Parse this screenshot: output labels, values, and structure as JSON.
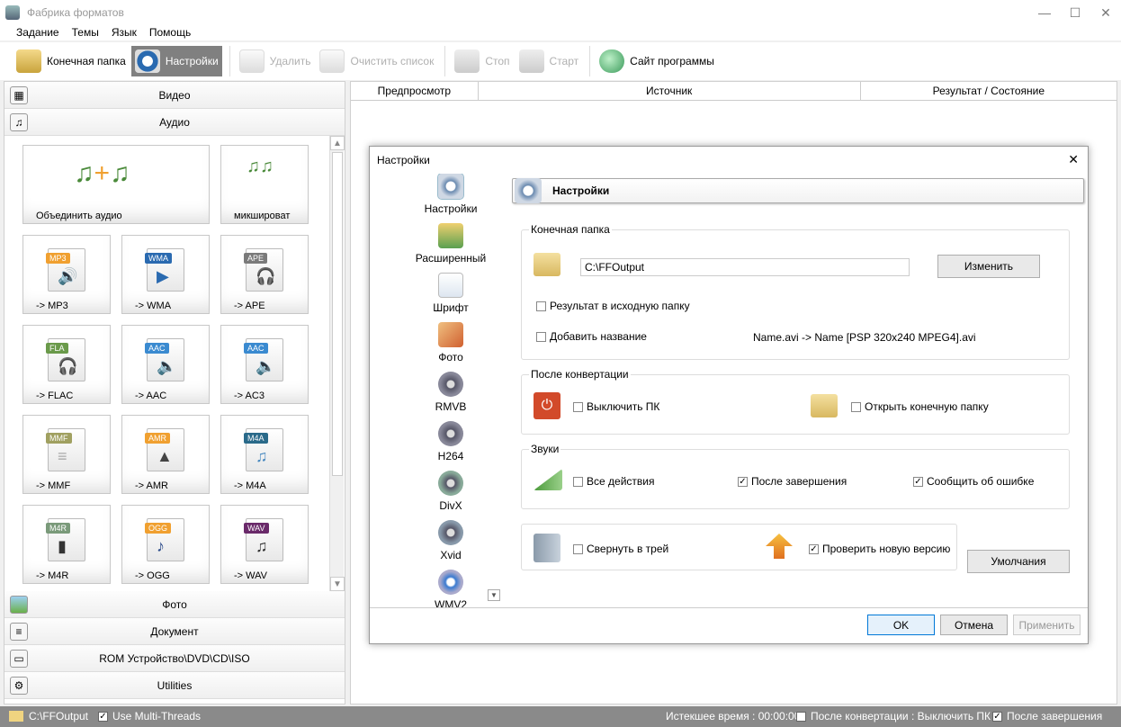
{
  "window": {
    "title": "Фабрика форматов",
    "controls": {
      "minimize": "—",
      "maximize": "☐",
      "close": "✕"
    }
  },
  "menu": [
    "Задание",
    "Темы",
    "Язык",
    "Помощь"
  ],
  "toolbar": {
    "output_folder": "Конечная папка",
    "settings": "Настройки",
    "delete": "Удалить",
    "clear_list": "Очистить список",
    "stop": "Стоп",
    "start": "Старт",
    "website": "Сайт программы"
  },
  "categories_top": [
    {
      "label": "Видео",
      "icon": "film-icon"
    },
    {
      "label": "Аудио",
      "icon": "music-icon"
    }
  ],
  "audio_tiles": [
    {
      "label": "Объединить аудио",
      "icon": "merge-audio-icon"
    },
    {
      "label": "микшироват",
      "icon": "mix-audio-icon"
    },
    {
      "label": "-> MP3",
      "tag": "MP3",
      "tag_color": "#f0a030",
      "glyph": "🔊"
    },
    {
      "label": "-> WMA",
      "tag": "WMA",
      "tag_color": "#2a6ab0",
      "glyph": "▶"
    },
    {
      "label": "-> APE",
      "tag": "APE",
      "tag_color": "#7a7a7a",
      "glyph": "🎧"
    },
    {
      "label": "-> FLAC",
      "tag": "FLA",
      "tag_color": "#6a9a4a",
      "glyph": "🎧"
    },
    {
      "label": "-> AAC",
      "tag": "AAC",
      "tag_color": "#3a8ad0",
      "glyph": "🔈"
    },
    {
      "label": "-> AC3",
      "tag": "AAC",
      "tag_color": "#3a8ad0",
      "glyph": "🔈"
    },
    {
      "label": "-> MMF",
      "tag": "MMF",
      "tag_color": "#a0a060",
      "glyph": "≡"
    },
    {
      "label": "-> AMR",
      "tag": "AMR",
      "tag_color": "#f0a030",
      "glyph": "▲"
    },
    {
      "label": "-> M4A",
      "tag": "M4A",
      "tag_color": "#2a6a8a",
      "glyph": "♫"
    },
    {
      "label": "-> M4R",
      "tag": "M4R",
      "tag_color": "#7a9a7a",
      "glyph": "▮"
    },
    {
      "label": "-> OGG",
      "tag": "OGG",
      "tag_color": "#f0a030",
      "glyph": "♪"
    },
    {
      "label": "-> WAV",
      "tag": "WAV",
      "tag_color": "#6a2a6a",
      "glyph": "♫"
    }
  ],
  "categories_bottom": [
    {
      "label": "Фото",
      "icon": "photo-icon"
    },
    {
      "label": "Документ",
      "icon": "document-icon"
    },
    {
      "label": "ROM Устройство\\DVD\\CD\\ISO",
      "icon": "disc-drive-icon"
    },
    {
      "label": "Utilities",
      "icon": "utilities-icon"
    }
  ],
  "table": {
    "columns": [
      "Предпросмотр",
      "Источник",
      "Результат / Состояние"
    ]
  },
  "dialog": {
    "title": "Настройки",
    "close": "✕",
    "nav": [
      "Настройки",
      "Расширенный",
      "Шрифт",
      "Фото",
      "RMVB",
      "H264",
      "DivX",
      "Xvid",
      "WMV2"
    ],
    "header": "Настройки",
    "output": {
      "title": "Конечная папка",
      "path": "C:\\FFOutput",
      "change_button": "Изменить",
      "to_source_folder": "Результат в исходную папку",
      "add_name": "Добавить название",
      "name_example": "Name.avi  -> Name [PSP 320x240 MPEG4].avi"
    },
    "after": {
      "title": "После конвертации",
      "shutdown": "Выключить ПК",
      "open_folder": "Открыть конечную папку"
    },
    "sounds": {
      "title": "Звуки",
      "all_actions": "Все действия",
      "after_finish": "После завершения",
      "report_error": "Сообщить об ошибке"
    },
    "misc": {
      "minimize_tray": "Свернуть в трей",
      "check_update": "Проверить новую версию"
    },
    "defaults_button": "Умолчания",
    "ok": "OK",
    "cancel": "Отмена",
    "apply": "Применить"
  },
  "status": {
    "path": "C:\\FFOutput",
    "multithreads": "Use Multi-Threads",
    "elapsed": "Истекшее время : 00:00:00",
    "after_convert": "После конвертации : Выключить ПК",
    "after_finish": "После завершения"
  },
  "colors": {
    "accent": "#0078d7",
    "status_bar": "#8a8a8a",
    "active_tool": "#808080"
  }
}
